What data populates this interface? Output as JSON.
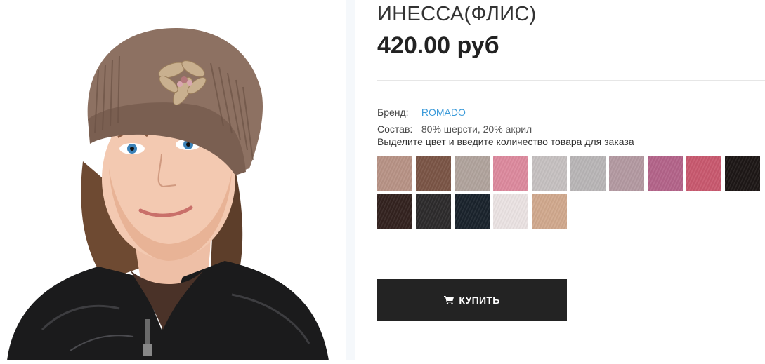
{
  "product": {
    "title": "ИНЕССА(ФЛИС)",
    "price": "420.00 руб",
    "image_alt": "knitted-beanie-hat-product-photo"
  },
  "attributes": [
    {
      "label": "Бренд:",
      "value": "ROMADO",
      "is_link": true
    },
    {
      "label": "Состав:",
      "value": "80% шерсти, 20% акрил",
      "is_link": false
    }
  ],
  "hint": "Выделите цвет и введите количество товара для заказа",
  "swatches": [
    {
      "color": "#b89386"
    },
    {
      "color": "#7b5546"
    },
    {
      "color": "#b1a49d"
    },
    {
      "color": "#dd8a9e"
    },
    {
      "color": "#c6c1c1"
    },
    {
      "color": "#b9b6b7"
    },
    {
      "color": "#b49aa2"
    },
    {
      "color": "#b4648a"
    },
    {
      "color": "#c9596f"
    },
    {
      "color": "#1d1716"
    },
    {
      "color": "#33221f"
    },
    {
      "color": "#2d2b2c"
    },
    {
      "color": "#1a232c"
    },
    {
      "color": "#ebe3e3"
    },
    {
      "color": "#d1a98e"
    }
  ],
  "buy_button": {
    "label": "КУПИТЬ",
    "icon": "cart-icon"
  }
}
